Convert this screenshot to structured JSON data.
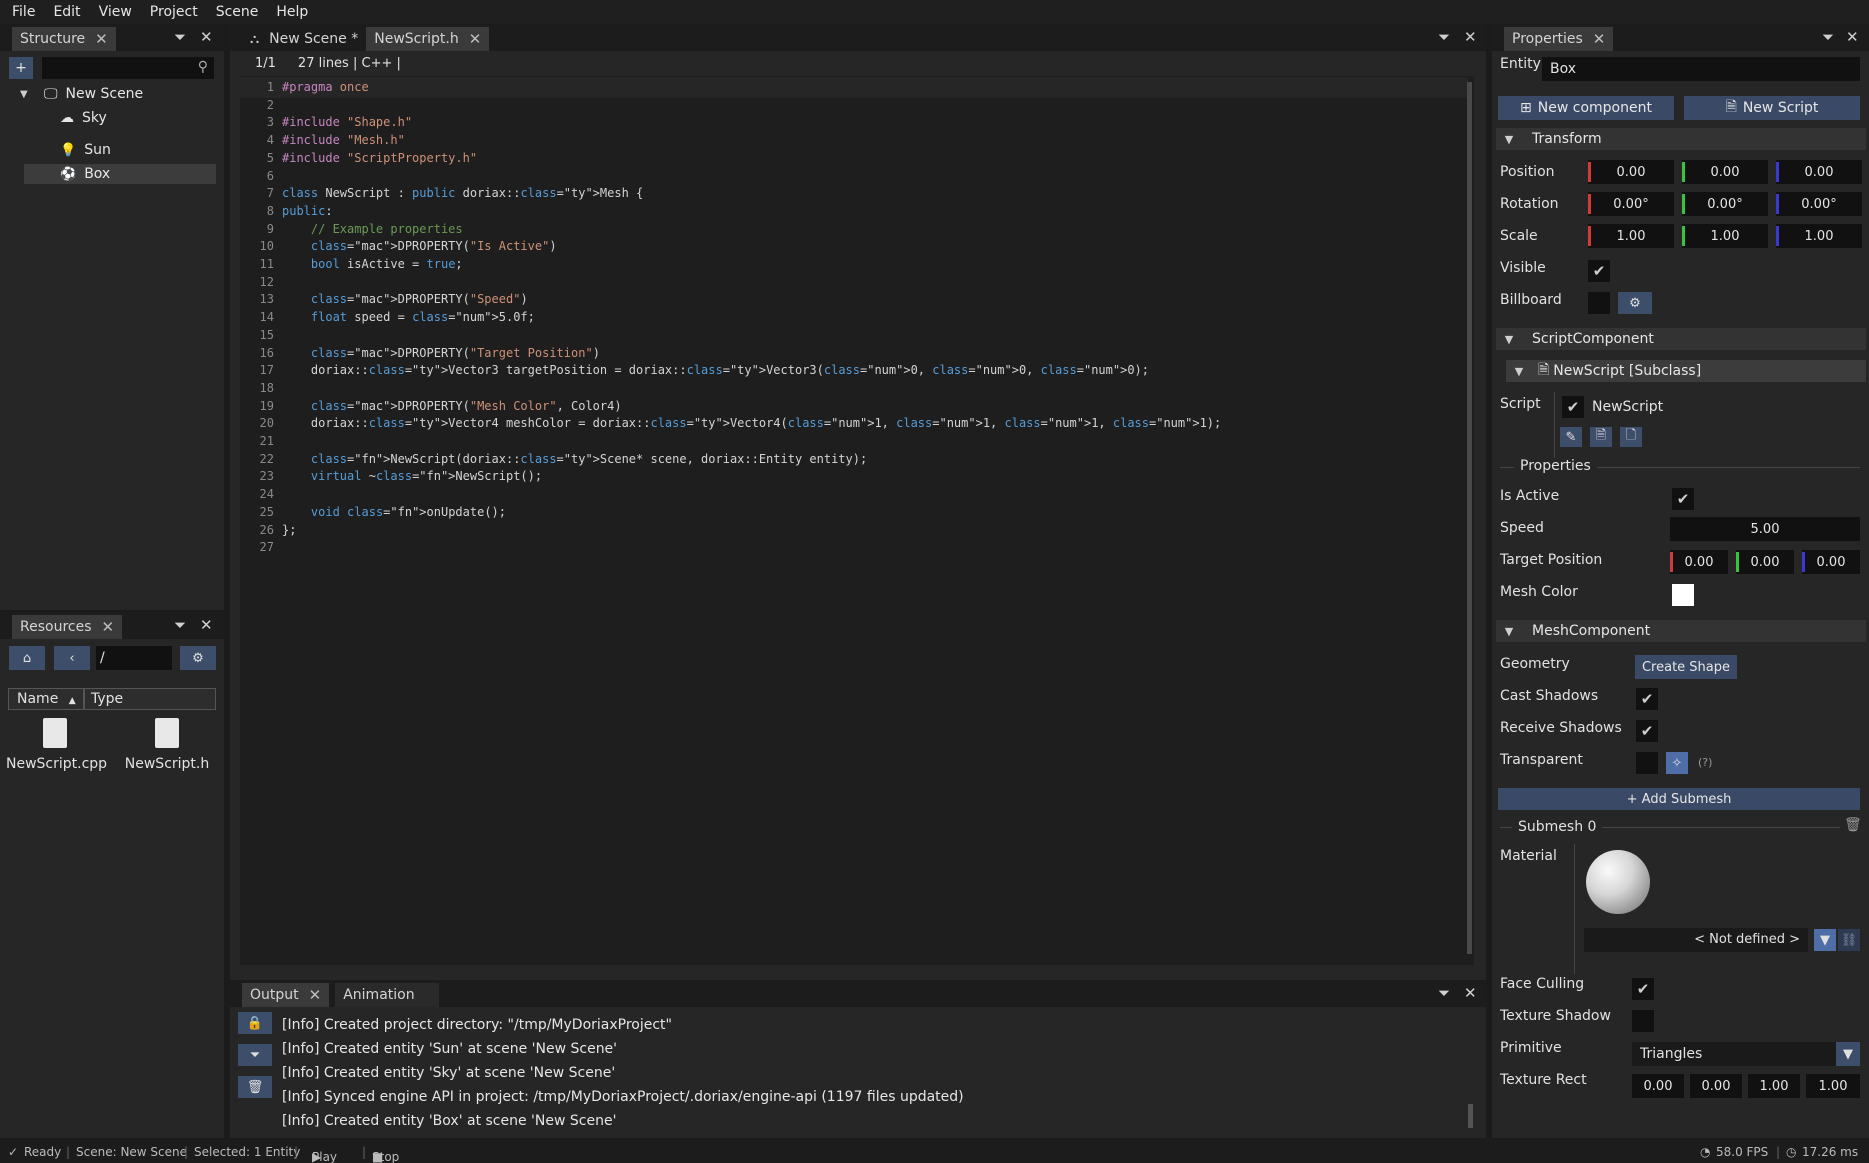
{
  "menu": [
    "File",
    "Edit",
    "View",
    "Project",
    "Scene",
    "Help"
  ],
  "structure": {
    "tab_label": "Structure",
    "add_label": "+",
    "search_placeholder": "",
    "scene_name": "New Scene",
    "items": [
      {
        "label": "Sky",
        "icon": "cloud-icon"
      },
      {
        "label": "Sun",
        "icon": "light-bulb-icon"
      },
      {
        "label": "Box",
        "icon": "mesh-icon"
      }
    ]
  },
  "resources": {
    "tab_label": "Resources",
    "path": "/",
    "col_name": "Name",
    "col_type": "Type",
    "files": [
      "NewScript.cpp",
      "NewScript.h"
    ]
  },
  "editor": {
    "tabs": [
      {
        "label": "New Scene *",
        "active": false
      },
      {
        "label": "NewScript.h",
        "active": true
      }
    ],
    "position": "1/1",
    "line_count": "27 lines",
    "language": "| C++ |",
    "lines": [
      "#pragma once",
      "",
      "#include \"Shape.h\"",
      "#include \"Mesh.h\"",
      "#include \"ScriptProperty.h\"",
      "",
      "class NewScript : public doriax::Mesh {",
      "public:",
      "    // Example properties",
      "    DPROPERTY(\"Is Active\")",
      "    bool isActive = true;",
      "",
      "    DPROPERTY(\"Speed\")",
      "    float speed = 5.0f;",
      "",
      "    DPROPERTY(\"Target Position\")",
      "    doriax::Vector3 targetPosition = doriax::Vector3(0, 0, 0);",
      "",
      "    DPROPERTY(\"Mesh Color\", Color4)",
      "    doriax::Vector4 meshColor = doriax::Vector4(1, 1, 1, 1);",
      "",
      "    NewScript(doriax::Scene* scene, doriax::Entity entity);",
      "    virtual ~NewScript();",
      "",
      "    void onUpdate();",
      "};",
      ""
    ]
  },
  "output": {
    "tabs": [
      "Output",
      "Animation"
    ],
    "lines": [
      "[Info] Created project directory: \"/tmp/MyDoriaxProject\"",
      "[Info] Created entity 'Sun' at scene 'New Scene'",
      "[Info] Created entity 'Sky' at scene 'New Scene'",
      "[Info] Synced engine API in project: /tmp/MyDoriaxProject/.doriax/engine-api (1197 files updated)",
      "[Info] Created entity 'Box' at scene 'New Scene'"
    ]
  },
  "properties": {
    "tab_label": "Properties",
    "entity_label": "Entity",
    "entity_value": "Box",
    "new_component": "New component",
    "new_script": "New Script",
    "transform": {
      "title": "Transform",
      "position_label": "Position",
      "position": [
        "0.00",
        "0.00",
        "0.00"
      ],
      "rotation_label": "Rotation",
      "rotation": [
        "0.00°",
        "0.00°",
        "0.00°"
      ],
      "scale_label": "Scale",
      "scale": [
        "1.00",
        "1.00",
        "1.00"
      ],
      "visible_label": "Visible",
      "billboard_label": "Billboard"
    },
    "script_component": {
      "title": "ScriptComponent",
      "subclass_title": "NewScript [Subclass]",
      "script_label": "Script",
      "script_name": "NewScript",
      "properties_header": "Properties",
      "is_active_label": "Is Active",
      "speed_label": "Speed",
      "speed_value": "5.00",
      "target_label": "Target Position",
      "target": [
        "0.00",
        "0.00",
        "0.00"
      ],
      "mesh_color_label": "Mesh Color"
    },
    "mesh_component": {
      "title": "MeshComponent",
      "geometry_label": "Geometry",
      "create_shape": "Create Shape",
      "cast_shadows_label": "Cast Shadows",
      "receive_shadows_label": "Receive Shadows",
      "transparent_label": "Transparent",
      "transparent_help": "(?)",
      "add_submesh": "+ Add Submesh",
      "submesh_title": "Submesh 0",
      "material_label": "Material",
      "material_value": "< Not defined >",
      "face_culling_label": "Face Culling",
      "texture_shadow_label": "Texture Shadow",
      "primitive_label": "Primitive",
      "primitive_value": "Triangles",
      "texture_rect_label": "Texture Rect",
      "texture_rect": [
        "0.00",
        "0.00",
        "1.00",
        "1.00"
      ]
    }
  },
  "status": {
    "ready": "Ready",
    "scene": "Scene: New Scene",
    "selected": "Selected: 1 Entity",
    "play": "Play",
    "stop": "Stop",
    "fps": "58.0 FPS",
    "frame_time": "17.26 ms"
  },
  "colors": {
    "accent": "#3a4a66",
    "axis_x": "#d33a3a",
    "axis_y": "#3ac43a",
    "axis_z": "#3a3ad3"
  }
}
